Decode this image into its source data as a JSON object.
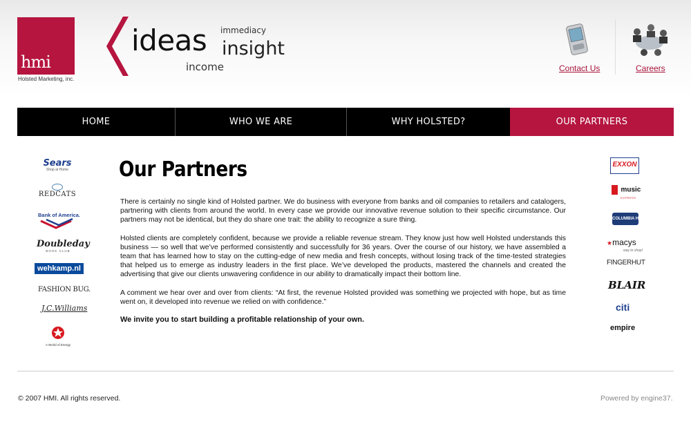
{
  "brand": {
    "logo_text": "hmi",
    "logo_caption": "Holsted Marketing, inc.",
    "tagline": {
      "big": "ideas",
      "top": "immediacy",
      "middle": "insight",
      "bottom": "income"
    },
    "accent_color": "#b5153f"
  },
  "top_links": {
    "contact": "Contact Us",
    "careers": "Careers"
  },
  "nav": [
    {
      "label": "HOME",
      "active": false
    },
    {
      "label": "WHO WE ARE",
      "active": false
    },
    {
      "label": "WHY HOLSTED?",
      "active": false
    },
    {
      "label": "OUR PARTNERS",
      "active": true
    }
  ],
  "page": {
    "title": "Our Partners",
    "paragraphs": [
      "There is certainly no single kind of Holsted partner. We do business with everyone from banks and oil companies to retailers and catalogers, partnering with clients from around the world. In every case we provide our innovative revenue solution to their specific circumstance. Our partners may not be identical, but they do share one trait: the ability to recognize a sure thing.",
      "Holsted clients are completely confident, because we provide a reliable revenue stream. They know just how well Holsted understands this business — so well that we’ve performed consistently and successfully for 36 years. Over the course of our history, we have assembled a team that has learned how to stay on the cutting-edge of new media and fresh concepts, without losing track of the time-tested strategies that helped us to emerge as industry leaders in the first place. We’ve developed the products, mastered the channels and created the advertising that give our clients unwavering confidence in our ability to dramatically impact their bottom line.",
      "A comment we hear over and over from clients: “At first, the revenue Holsted provided was something we projected with hope, but as time went on, it developed into revenue we relied on with confidence.”",
      "We invite you to start building a profitable relationship of your own."
    ]
  },
  "partners_left": {
    "sears": "Sears",
    "sears_sub": "Shop at Home",
    "redcats": "REDCATS",
    "bofa": "Bank of America.",
    "doubleday": "Doubleday",
    "doubleday_sub": "BOOK CLUB",
    "wehkamp": "wehkamp.nl",
    "fashionbug": "FASHION BUG.",
    "jcwilliams": "J.C.Williams",
    "texaco_sub": "A World of Energy"
  },
  "partners_right": {
    "exxon": "EXXON",
    "musicclub": "music",
    "musicclub_sub": "EXPRESS",
    "columbia": "COLUMBIA HOUSE",
    "macys": "macys",
    "macys_sub": "way to shop!",
    "fingerhut": "FINGERHUT",
    "blair": "BLAIR",
    "citi": "citi",
    "empire": "empire"
  },
  "footer": {
    "copyright": "© 2007 HMI. All rights reserved.",
    "powered": "Powered by engine37."
  }
}
